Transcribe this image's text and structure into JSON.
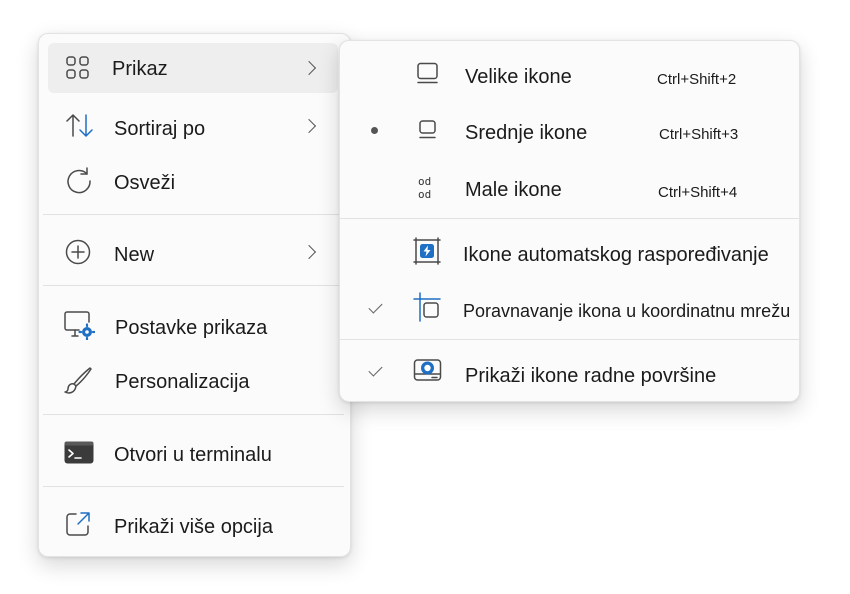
{
  "main_menu": {
    "items": [
      {
        "label": "Prikaz",
        "icon": "grid-icon",
        "has_submenu": true
      },
      {
        "label": "Sortiraj po",
        "icon": "sort-arrows-icon",
        "has_submenu": true
      },
      {
        "label": "Osveži",
        "icon": "refresh-icon",
        "has_submenu": false
      },
      {
        "label": "New",
        "icon": "add-circle-icon",
        "has_submenu": true
      },
      {
        "label": "Postavke prikaza",
        "icon": "display-settings-icon",
        "has_submenu": false
      },
      {
        "label": "Personalizacija",
        "icon": "paintbrush-icon",
        "has_submenu": false
      },
      {
        "label": "Otvori u terminalu",
        "icon": "terminal-icon",
        "has_submenu": false
      },
      {
        "label": "Prikaži više opcija",
        "icon": "open-external-icon",
        "has_submenu": false
      }
    ]
  },
  "sub_menu": {
    "items": [
      {
        "label": "Velike ikone",
        "shortcut": "Ctrl+Shift+2",
        "icon": "large-icons-icon",
        "selected": false
      },
      {
        "label": "Srednje ikone",
        "shortcut": "Ctrl+Shift+3",
        "icon": "medium-icons-icon",
        "selected": true
      },
      {
        "label": "Male ikone",
        "shortcut": "Ctrl+Shift+4",
        "icon": "small-icons-icon",
        "icon_text": "od",
        "selected": false
      },
      {
        "label": "Ikone automatskog raspoređivanje",
        "icon": "auto-arrange-icon",
        "checked": false
      },
      {
        "label": "Poravnavanje ikona u koordinatnu mrežu",
        "icon": "align-grid-icon",
        "checked": true
      },
      {
        "label": "Prikaži ikone radne površine",
        "icon": "show-desktop-icons-icon",
        "checked": true
      }
    ]
  },
  "colors": {
    "accent": "#1f6fc5",
    "icon_stroke": "#4a4a4a",
    "menu_bg": "#fbfbfb",
    "hover_bg": "#eeeeee"
  }
}
